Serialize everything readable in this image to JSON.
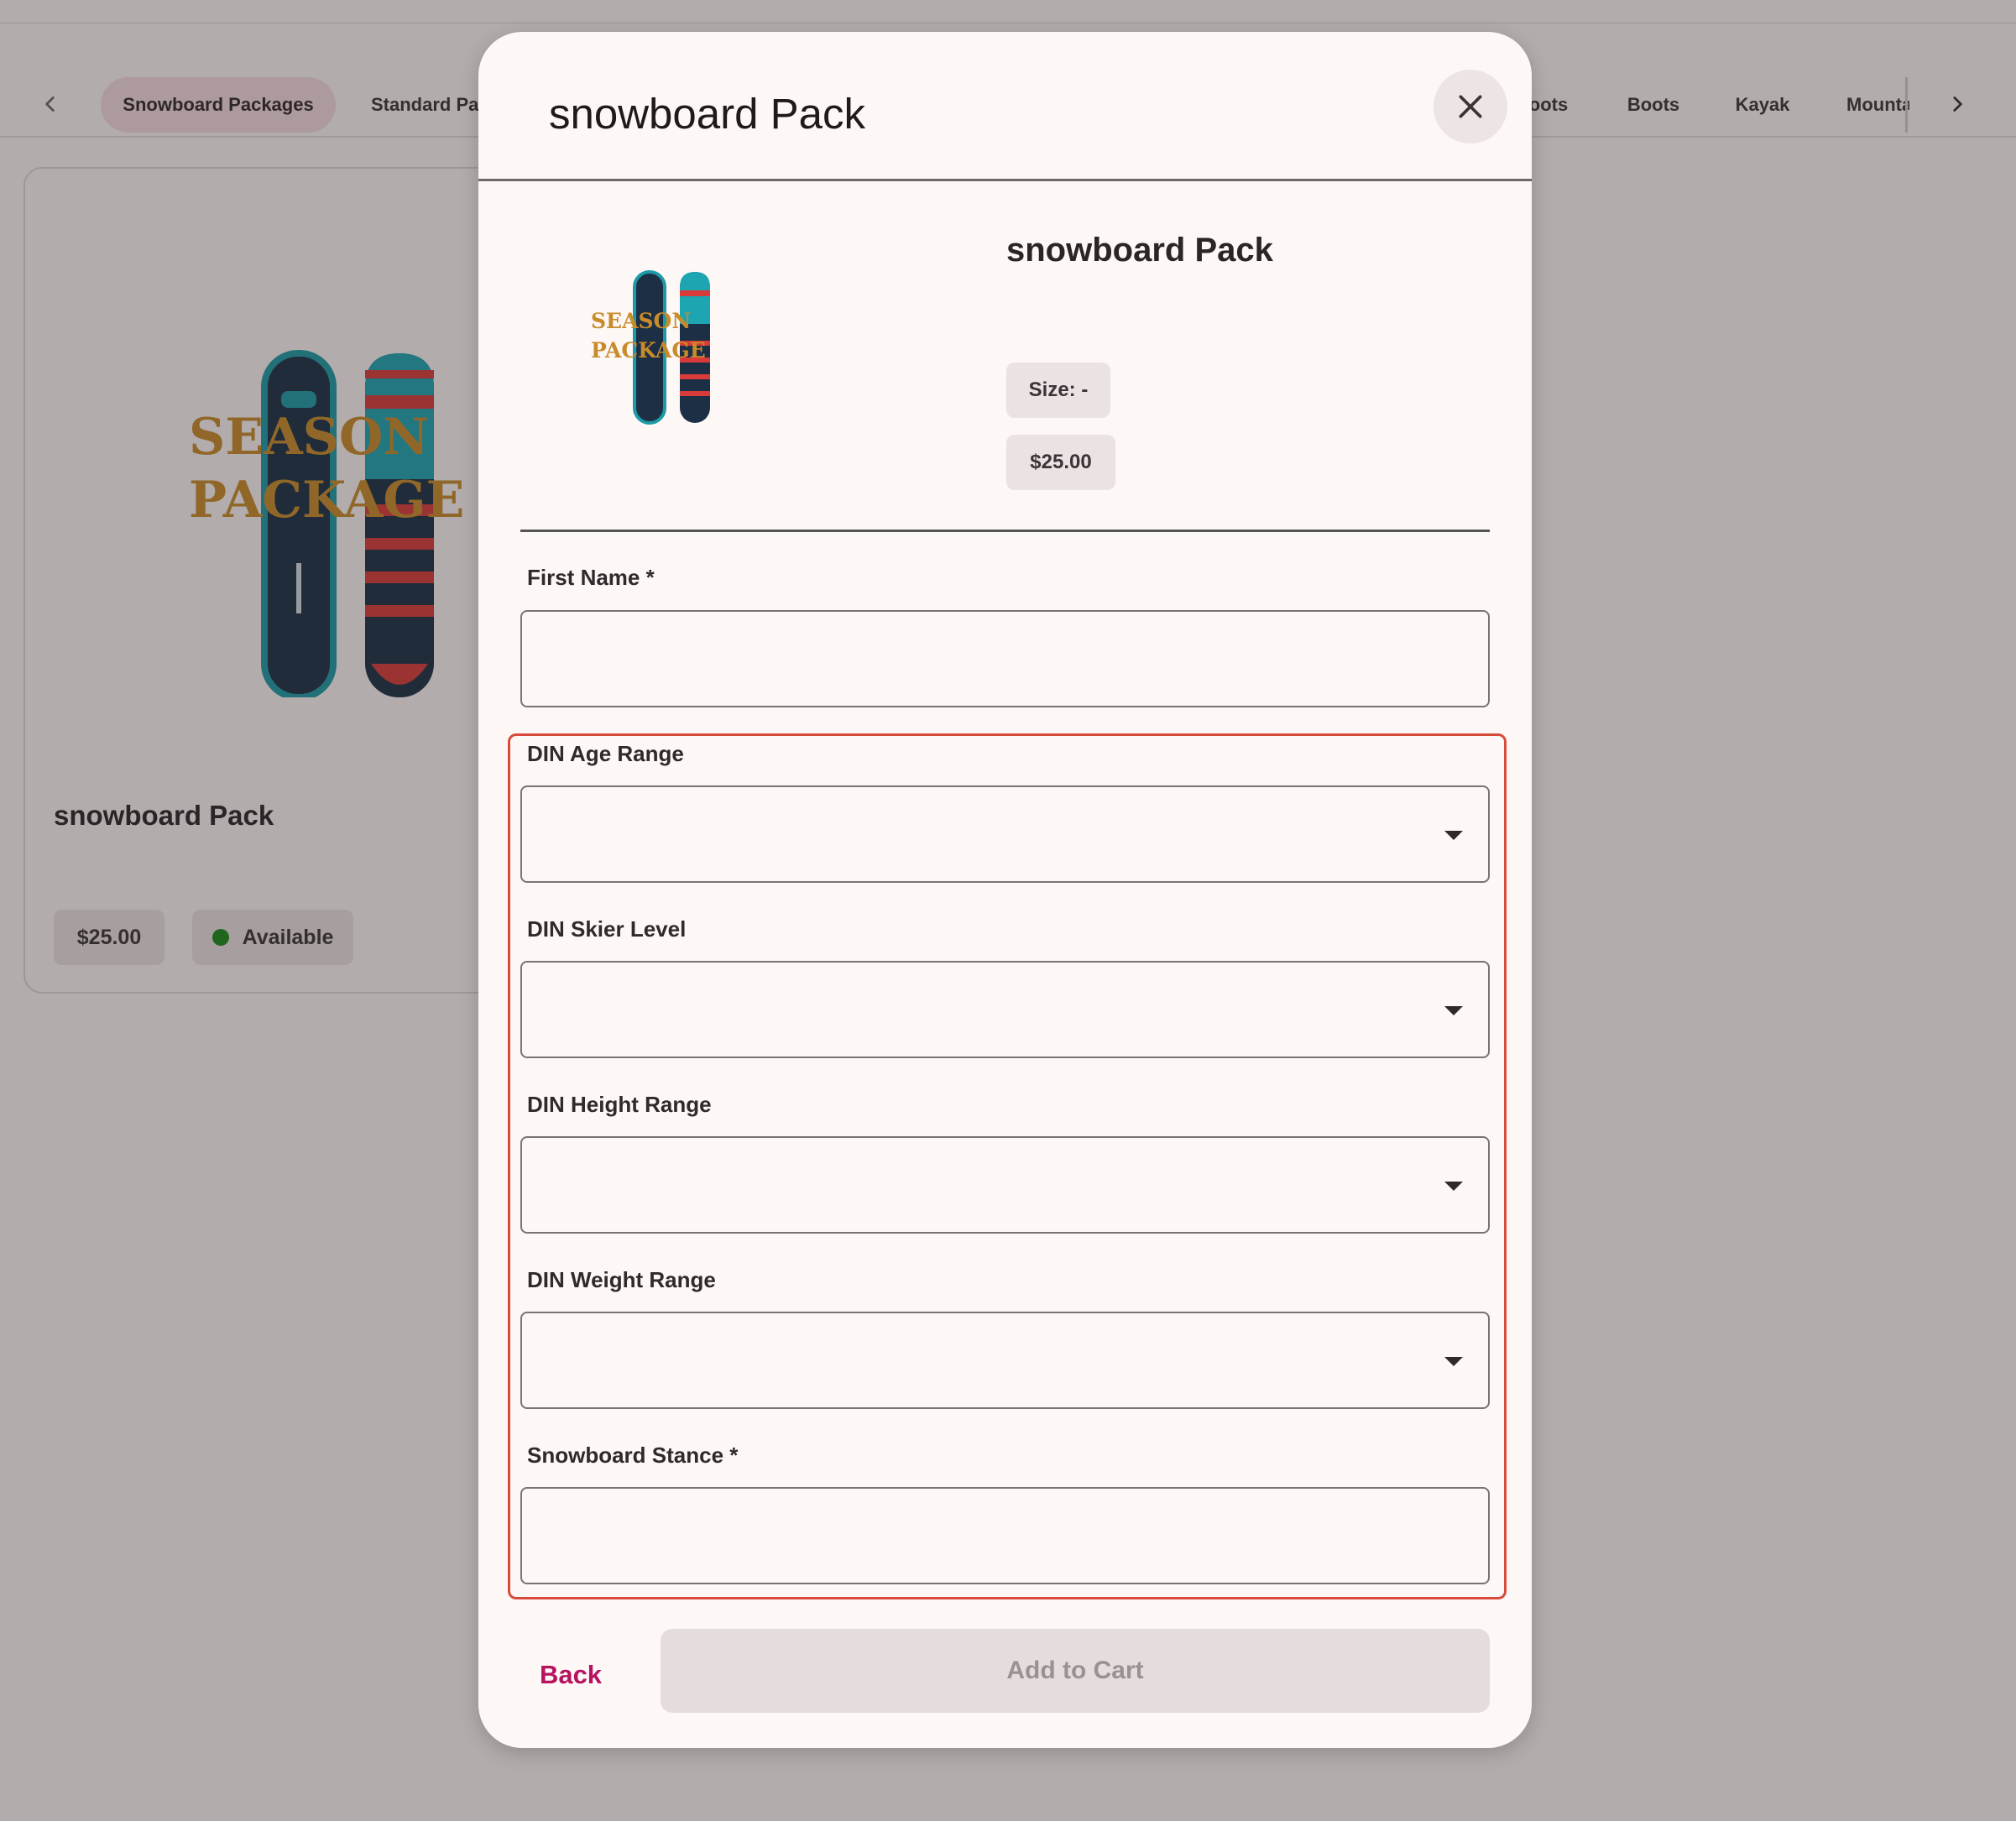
{
  "nav": {
    "categories": [
      {
        "label": "Snowboard Packages",
        "active": true
      },
      {
        "label": "Standard Pa"
      },
      {
        "label": "oots"
      },
      {
        "label": "Boots"
      },
      {
        "label": "Kayak"
      },
      {
        "label": "Mounta"
      }
    ],
    "prev_icon": "chevron-left-icon",
    "next_icon": "chevron-right-icon"
  },
  "card": {
    "image_text": [
      "SEASON",
      "PACKAGE"
    ],
    "title": "snowboard Pack",
    "price": "$25.00",
    "status": "Available",
    "status_color": "#1b8a1b"
  },
  "modal": {
    "title": "snowboard Pack",
    "close_icon": "close-icon",
    "product_name": "snowboard Pack",
    "thumb_text": [
      "SEASON",
      "PACKAGE"
    ],
    "size_label": "Size: -",
    "price": "$25.00",
    "fields": {
      "first_name": {
        "label": "First Name *",
        "value": ""
      },
      "din_age": {
        "label": "DIN Age Range",
        "value": ""
      },
      "din_skier": {
        "label": "DIN Skier Level",
        "value": ""
      },
      "din_height": {
        "label": "DIN Height Range",
        "value": ""
      },
      "din_weight": {
        "label": "DIN Weight Range",
        "value": ""
      },
      "stance": {
        "label": "Snowboard Stance *",
        "value": ""
      }
    },
    "back_label": "Back",
    "add_label": "Add to Cart",
    "accent_color": "#b6135f",
    "highlight_color": "#d84b3b"
  }
}
